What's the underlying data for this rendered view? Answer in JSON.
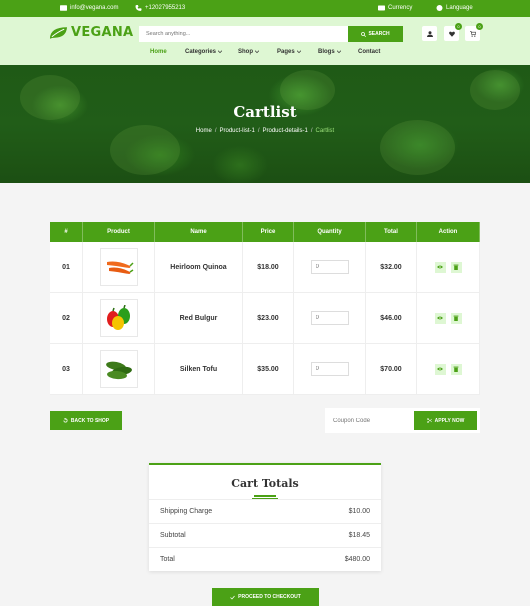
{
  "topbar": {
    "email": "info@vegana.com",
    "phone": "+12027955213",
    "currency": "Currency",
    "language": "Language"
  },
  "header": {
    "logo": "VEGANA",
    "search_placeholder": "Search anything...",
    "search_button": "SEARCH",
    "wishlist_count": "0",
    "cart_count": "0"
  },
  "nav": {
    "home": "Home",
    "categories": "Categories",
    "shop": "Shop",
    "pages": "Pages",
    "blogs": "Blogs",
    "contact": "Contact"
  },
  "hero": {
    "title": "Cartlist",
    "crumb1": "Home",
    "crumb2": "Product-list-1",
    "crumb3": "Product-details-1",
    "crumb4": "Cartlist"
  },
  "table": {
    "headers": [
      "#",
      "Product",
      "Name",
      "Price",
      "Quantity",
      "Total",
      "Action"
    ],
    "rows": [
      {
        "num": "01",
        "name": "Heirloom Quinoa",
        "price": "$18.00",
        "qty": "0",
        "total": "$32.00",
        "image": "carrot"
      },
      {
        "num": "02",
        "name": "Red Bulgur",
        "price": "$23.00",
        "qty": "0",
        "total": "$46.00",
        "image": "peppers"
      },
      {
        "num": "03",
        "name": "Silken Tofu",
        "price": "$35.00",
        "qty": "0",
        "total": "$70.00",
        "image": "cucumbers"
      }
    ]
  },
  "actions": {
    "back_to_shop": "BACK TO SHOP",
    "coupon_placeholder": "Coupon Code",
    "apply_now": "APPLY NOW"
  },
  "totals": {
    "title": "Cart Totals",
    "shipping_label": "Shipping Charge",
    "shipping_value": "$10.00",
    "subtotal_label": "Subtotal",
    "subtotal_value": "$18.45",
    "total_label": "Total",
    "total_value": "$480.00",
    "checkout": "PROCEED TO CHECKOUT"
  },
  "colors": {
    "accent": "#4ba116",
    "header_bg": "#def7d3"
  }
}
